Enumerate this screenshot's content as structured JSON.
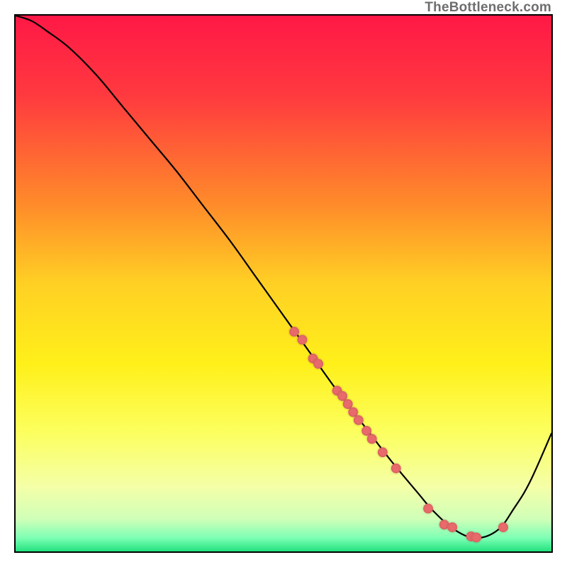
{
  "watermark": "TheBottleneck.com",
  "chart_data": {
    "type": "line",
    "title": "",
    "xlabel": "",
    "ylabel": "",
    "xlim": [
      0,
      100
    ],
    "ylim": [
      0,
      100
    ],
    "grid": false,
    "legend": false,
    "gradient_stops": [
      {
        "pos": 0.0,
        "color": "#ff1846"
      },
      {
        "pos": 0.15,
        "color": "#ff3a3f"
      },
      {
        "pos": 0.35,
        "color": "#ff8a2a"
      },
      {
        "pos": 0.5,
        "color": "#ffd024"
      },
      {
        "pos": 0.65,
        "color": "#fff01a"
      },
      {
        "pos": 0.78,
        "color": "#fcff60"
      },
      {
        "pos": 0.88,
        "color": "#f4ffa8"
      },
      {
        "pos": 0.94,
        "color": "#cfffb8"
      },
      {
        "pos": 0.975,
        "color": "#7dffb4"
      },
      {
        "pos": 1.0,
        "color": "#23e27f"
      }
    ],
    "series": [
      {
        "name": "bottleneck-curve",
        "x": [
          0,
          3,
          6,
          10,
          15,
          20,
          25,
          30,
          35,
          40,
          45,
          50,
          55,
          60,
          65,
          70,
          75,
          78,
          82,
          86,
          90,
          93,
          96,
          100
        ],
        "y": [
          100,
          99,
          97,
          94,
          89,
          83,
          77,
          71,
          64.5,
          58,
          51,
          44,
          37,
          30,
          23.5,
          17,
          11,
          7.5,
          4,
          2.5,
          4,
          8,
          13,
          22
        ]
      }
    ],
    "scatter_points": {
      "name": "highlighted-samples",
      "x": [
        52,
        53.5,
        55.5,
        56.5,
        60,
        61,
        62,
        63,
        64,
        65.5,
        66.5,
        68.5,
        71,
        77,
        80,
        81.5,
        85,
        86,
        91
      ],
      "y": [
        41,
        39.5,
        36,
        35,
        30,
        29,
        27.5,
        26,
        24.5,
        22.5,
        21,
        18.5,
        15.5,
        8,
        5,
        4.5,
        2.8,
        2.6,
        4.5
      ],
      "r": 7
    }
  }
}
